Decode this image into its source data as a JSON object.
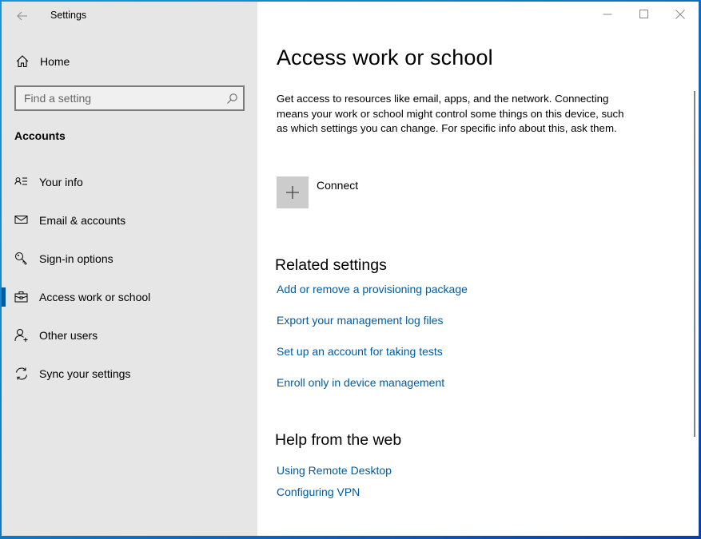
{
  "window": {
    "title": "Settings",
    "controls": {
      "minimize": "minimize",
      "maximize": "maximize",
      "close": "close"
    }
  },
  "sidebar": {
    "home_label": "Home",
    "search": {
      "placeholder": "Find a setting",
      "value": ""
    },
    "section_title": "Accounts",
    "items": [
      {
        "label": "Your info",
        "icon": "person-list-icon",
        "active": false
      },
      {
        "label": "Email & accounts",
        "icon": "mail-icon",
        "active": false
      },
      {
        "label": "Sign-in options",
        "icon": "key-icon",
        "active": false
      },
      {
        "label": "Access work or school",
        "icon": "briefcase-icon",
        "active": true
      },
      {
        "label": "Other users",
        "icon": "person-add-icon",
        "active": false
      },
      {
        "label": "Sync your settings",
        "icon": "sync-icon",
        "active": false
      }
    ]
  },
  "main": {
    "title": "Access work or school",
    "description": "Get access to resources like email, apps, and the network. Connecting means your work or school might control some things on this device, such as which settings you can change. For specific info about this, ask them.",
    "connect_label": "Connect",
    "related": {
      "heading": "Related settings",
      "links": [
        "Add or remove a provisioning package",
        "Export your management log files",
        "Set up an account for taking tests",
        "Enroll only in device management"
      ]
    },
    "help": {
      "heading": "Help from the web",
      "links": [
        "Using Remote Desktop",
        "Configuring VPN"
      ]
    }
  },
  "colors": {
    "accent": "#005a9e",
    "sidebar_bg": "#e6e6e6",
    "link": "#005a9e",
    "connect_tile": "#cccccc"
  }
}
